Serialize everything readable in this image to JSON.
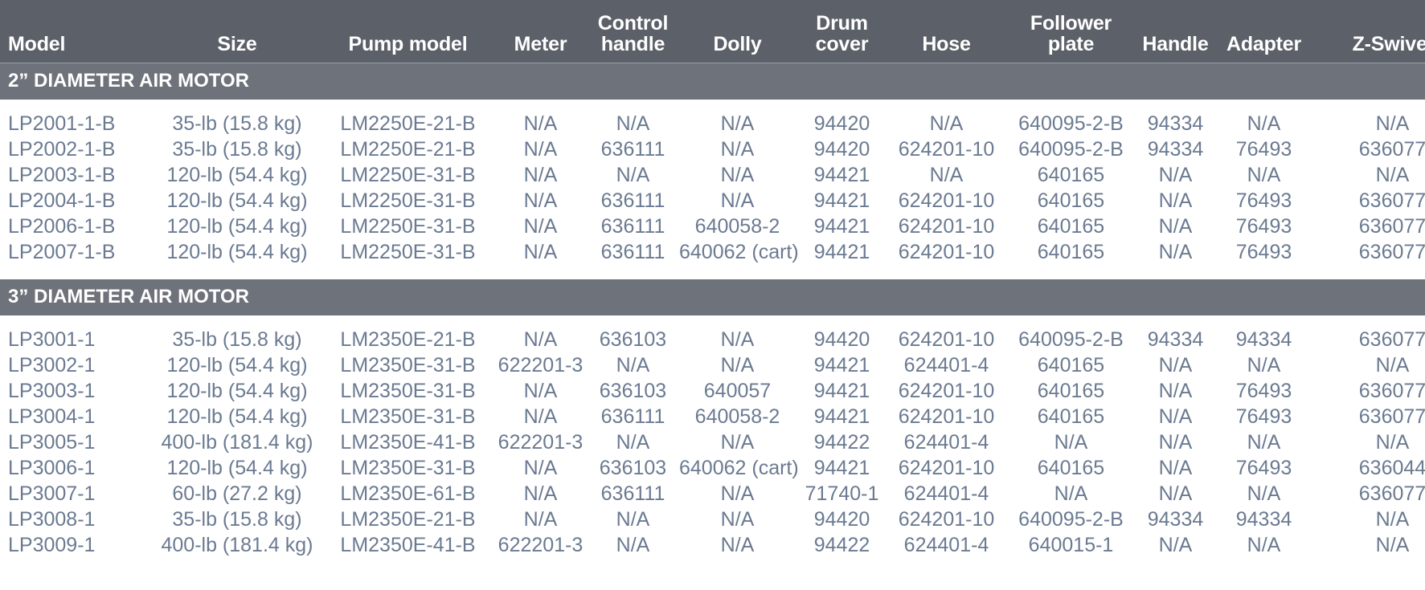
{
  "table": {
    "columns": [
      {
        "key": "model",
        "label": "Model"
      },
      {
        "key": "size",
        "label": "Size"
      },
      {
        "key": "pump",
        "label": "Pump model"
      },
      {
        "key": "meter",
        "label": "Meter"
      },
      {
        "key": "control",
        "label": "Control\nhandle"
      },
      {
        "key": "dolly",
        "label": "Dolly"
      },
      {
        "key": "drum",
        "label": "Drum\ncover"
      },
      {
        "key": "hose",
        "label": "Hose"
      },
      {
        "key": "follower",
        "label": "Follower\nplate"
      },
      {
        "key": "handle",
        "label": "Handle"
      },
      {
        "key": "adapter",
        "label": "Adapter"
      },
      {
        "key": "zswivel",
        "label": "Z-Swivel"
      }
    ],
    "sections": [
      {
        "title": "2” DIAMETER AIR MOTOR",
        "rows": [
          [
            "LP2001-1-B",
            "35-lb (15.8 kg)",
            "LM2250E-21-B",
            "N/A",
            "N/A",
            "N/A",
            "94420",
            "N/A",
            "640095-2-B",
            "94334",
            "N/A",
            "N/A"
          ],
          [
            "LP2002-1-B",
            "35-lb (15.8 kg)",
            "LM2250E-21-B",
            "N/A",
            "636111",
            "N/A",
            "94420",
            "624201-10",
            "640095-2-B",
            "94334",
            "76493",
            "636077"
          ],
          [
            "LP2003-1-B",
            "120-lb (54.4 kg)",
            "LM2250E-31-B",
            "N/A",
            "N/A",
            "N/A",
            "94421",
            "N/A",
            "640165",
            "N/A",
            "N/A",
            "N/A"
          ],
          [
            "LP2004-1-B",
            "120-lb (54.4 kg)",
            "LM2250E-31-B",
            "N/A",
            "636111",
            "N/A",
            "94421",
            "624201-10",
            "640165",
            "N/A",
            "76493",
            "636077"
          ],
          [
            "LP2006-1-B",
            "120-lb (54.4 kg)",
            "LM2250E-31-B",
            "N/A",
            "636111",
            "640058-2",
            "94421",
            "624201-10",
            "640165",
            "N/A",
            "76493",
            "636077"
          ],
          [
            "LP2007-1-B",
            "120-lb (54.4 kg)",
            "LM2250E-31-B",
            "N/A",
            "636111",
            "640062 (cart)",
            "94421",
            "624201-10",
            "640165",
            "N/A",
            "76493",
            "636077"
          ]
        ]
      },
      {
        "title": "3” DIAMETER AIR MOTOR",
        "rows": [
          [
            "LP3001-1",
            "35-lb (15.8 kg)",
            "LM2350E-21-B",
            "N/A",
            "636103",
            "N/A",
            "94420",
            "624201-10",
            "640095-2-B",
            "94334",
            "94334",
            "636077"
          ],
          [
            "LP3002-1",
            "120-lb (54.4 kg)",
            "LM2350E-31-B",
            "622201-3",
            "N/A",
            "N/A",
            "94421",
            "624401-4",
            "640165",
            "N/A",
            "N/A",
            "N/A"
          ],
          [
            "LP3003-1",
            "120-lb (54.4 kg)",
            "LM2350E-31-B",
            "N/A",
            "636103",
            "640057",
            "94421",
            "624201-10",
            "640165",
            "N/A",
            "76493",
            "636077"
          ],
          [
            "LP3004-1",
            "120-lb (54.4 kg)",
            "LM2350E-31-B",
            "N/A",
            "636111",
            "640058-2",
            "94421",
            "624201-10",
            "640165",
            "N/A",
            "76493",
            "636077"
          ],
          [
            "LP3005-1",
            "400-lb (181.4 kg)",
            "LM2350E-41-B",
            "622201-3",
            "N/A",
            "N/A",
            "94422",
            "624401-4",
            "N/A",
            "N/A",
            "N/A",
            "N/A"
          ],
          [
            "LP3006-1",
            "120-lb (54.4 kg)",
            "LM2350E-31-B",
            "N/A",
            "636103",
            "640062 (cart)",
            "94421",
            "624201-10",
            "640165",
            "N/A",
            "76493",
            "636044"
          ],
          [
            "LP3007-1",
            "60-lb (27.2 kg)",
            "LM2350E-61-B",
            "N/A",
            "636111",
            "N/A",
            "71740-1",
            "624401-4",
            "N/A",
            "N/A",
            "N/A",
            "636077"
          ],
          [
            "LP3008-1",
            "35-lb (15.8 kg)",
            "LM2350E-21-B",
            "N/A",
            "N/A",
            "N/A",
            "94420",
            "624201-10",
            "640095-2-B",
            "94334",
            "94334",
            "N/A"
          ],
          [
            "LP3009-1",
            "400-lb (181.4 kg)",
            "LM2350E-41-B",
            "622201-3",
            "N/A",
            "N/A",
            "94422",
            "624401-4",
            "640015-1",
            "N/A",
            "N/A",
            "N/A"
          ]
        ]
      }
    ]
  },
  "colors": {
    "header_bg": "#5c6068",
    "section_bg": "#6e727a",
    "header_text": "#ffffff",
    "data_text": "#6b7a91",
    "page_bg": "#ffffff"
  }
}
